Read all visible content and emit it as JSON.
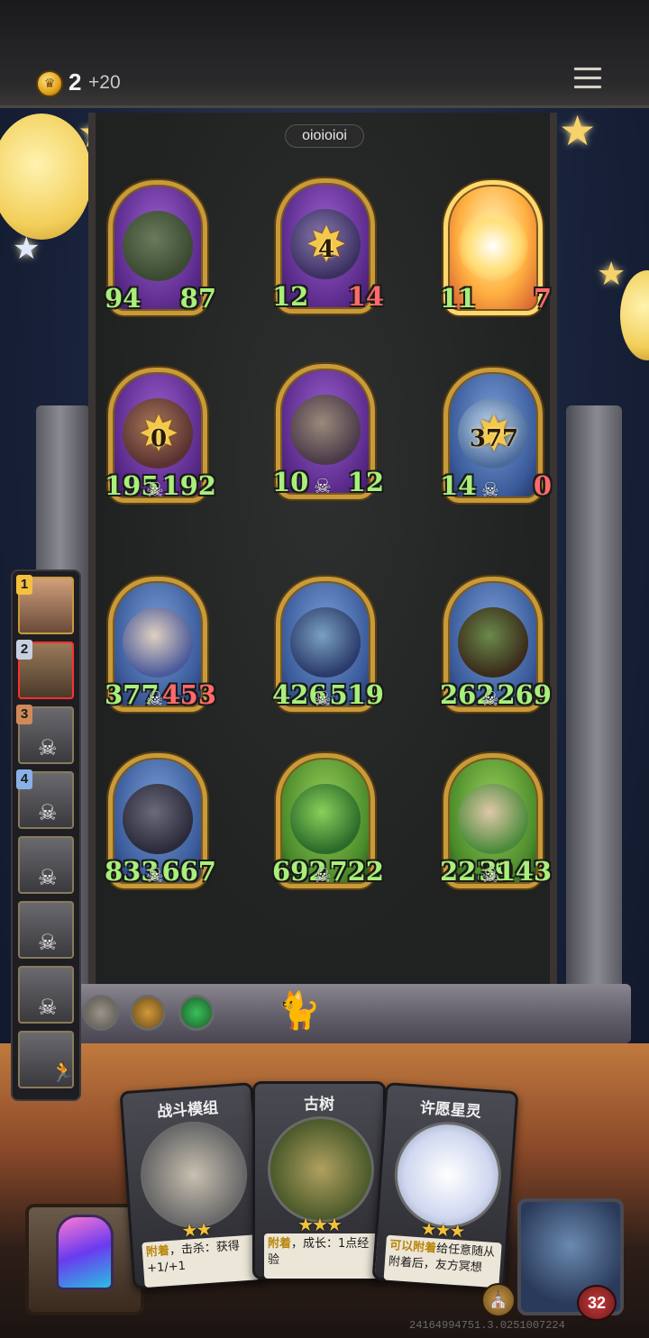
{
  "topbar": {
    "coins": "2",
    "income": "+20",
    "coin_icon": "crown-coin-icon",
    "menu_icon": "hamburger-menu-icon"
  },
  "opponent": {
    "name": "oioioioi"
  },
  "board": {
    "units": [
      {
        "name": "rock-golem",
        "attack": "94",
        "health": "87",
        "counter": "",
        "skull": false,
        "health_hurt": false
      },
      {
        "name": "wolf-beast",
        "attack": "12",
        "health": "14",
        "counter": "4",
        "skull": false,
        "health_hurt": true
      },
      {
        "name": "glowing-card",
        "attack": "11",
        "health": "7",
        "counter": "",
        "skull": false,
        "health_hurt": true
      },
      {
        "name": "dark-bird",
        "attack": "195",
        "health": "192",
        "counter": "0",
        "skull": true,
        "health_hurt": false
      },
      {
        "name": "zeppelin",
        "attack": "10",
        "health": "12",
        "counter": "",
        "skull": true,
        "health_hurt": false
      },
      {
        "name": "spectral-zeppelin",
        "attack": "14",
        "health": "0",
        "counter": "377",
        "skull": true,
        "health_hurt": true
      },
      {
        "name": "wizard",
        "attack": "377",
        "health": "453",
        "counter": "",
        "skull": true,
        "health_hurt": true
      },
      {
        "name": "dark-elf",
        "attack": "426",
        "health": "519",
        "counter": "",
        "skull": true,
        "health_hurt": false
      },
      {
        "name": "goblin",
        "attack": "262",
        "health": "269",
        "counter": "",
        "skull": true,
        "health_hurt": false
      },
      {
        "name": "robot",
        "attack": "833",
        "health": "667",
        "counter": "",
        "skull": true,
        "health_hurt": false
      },
      {
        "name": "dryad",
        "attack": "692",
        "health": "722",
        "counter": "",
        "skull": true,
        "health_hurt": false
      },
      {
        "name": "sprout-girl",
        "attack": "2239",
        "health": "3143",
        "counter": "",
        "skull": true,
        "health_hurt": false
      }
    ]
  },
  "players": [
    {
      "rank": "1",
      "state": "alive"
    },
    {
      "rank": "2",
      "state": "active"
    },
    {
      "rank": "3",
      "state": "dead"
    },
    {
      "rank": "4",
      "state": "dead"
    },
    {
      "rank": "",
      "state": "dead"
    },
    {
      "rank": "",
      "state": "dead"
    },
    {
      "rank": "",
      "state": "dead"
    },
    {
      "rank": "",
      "state": "runner"
    }
  ],
  "hand": [
    {
      "title": "战斗模组",
      "stars": "★★",
      "desc_kw": "附着",
      "desc_rest": "，击杀：获得+1/+1"
    },
    {
      "title": "古树",
      "stars": "★★★",
      "desc_kw": "附着",
      "desc_rest": "，成长：1点经验"
    },
    {
      "title": "许愿星灵",
      "stars": "★★★",
      "desc_kw": "可以附着",
      "desc_rest": "给任意随从附着后，友方冥想"
    }
  ],
  "hero": {
    "health": "32"
  },
  "build_id": "24164994751.3.0251007224"
}
